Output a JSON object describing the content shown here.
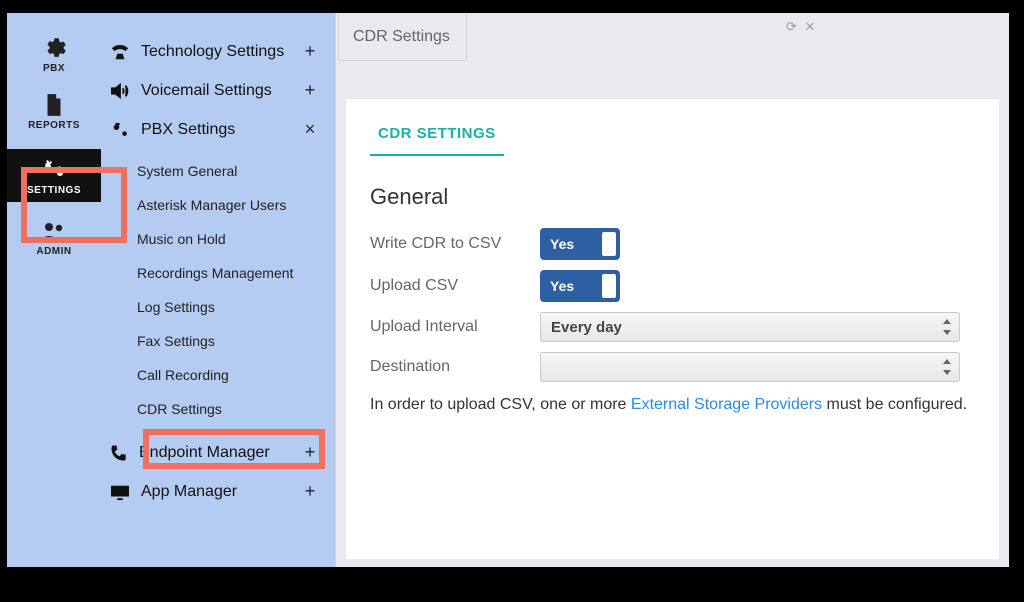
{
  "rail": {
    "items": [
      {
        "label": "PBX"
      },
      {
        "label": "REPORTS"
      },
      {
        "label": "SETTINGS"
      },
      {
        "label": "ADMIN"
      }
    ]
  },
  "sidebar": {
    "sections": {
      "technology": {
        "label": "Technology Settings",
        "expander": "+"
      },
      "voicemail": {
        "label": "Voicemail Settings",
        "expander": "+"
      },
      "pbx": {
        "label": "PBX Settings",
        "expander": "×"
      },
      "endpoint": {
        "label": "Endpoint Manager",
        "expander": "+"
      },
      "app": {
        "label": "App Manager",
        "expander": "+"
      }
    },
    "pbx_sub": [
      "System General",
      "Asterisk Manager Users",
      "Music on Hold",
      "Recordings Management",
      "Log Settings",
      "Fax Settings",
      "Call Recording",
      "CDR Settings"
    ]
  },
  "main": {
    "tab_label": "CDR Settings",
    "tab_controls": "⟳ ✕",
    "panel_tab": "CDR SETTINGS",
    "section_title": "General",
    "fields": {
      "write_csv": {
        "label": "Write CDR to CSV",
        "value": "Yes"
      },
      "upload_csv": {
        "label": "Upload CSV",
        "value": "Yes"
      },
      "interval": {
        "label": "Upload Interval",
        "value": "Every day"
      },
      "destination": {
        "label": "Destination",
        "value": ""
      }
    },
    "helper_pre": "In order to upload CSV, one or more ",
    "helper_link": "External Storage Providers",
    "helper_post": " must be configured."
  }
}
